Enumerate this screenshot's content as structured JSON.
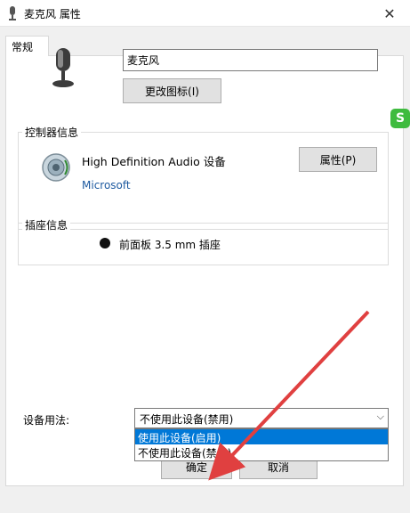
{
  "window": {
    "title": "麦克风 属性"
  },
  "tabs": [
    {
      "label": "常规"
    }
  ],
  "device": {
    "name_value": "麦克风",
    "change_icon_label": "更改图标(I)"
  },
  "controller": {
    "group_label": "控制器信息",
    "device_name": "High Definition Audio 设备",
    "manufacturer": "Microsoft",
    "properties_label": "属性(P)"
  },
  "jack": {
    "group_label": "插座信息",
    "description": "前面板 3.5 mm 插座",
    "color": "#111111"
  },
  "usage": {
    "label": "设备用法:",
    "selected": "不使用此设备(禁用)",
    "options": [
      {
        "label": "使用此设备(启用)",
        "highlighted": true
      },
      {
        "label": "不使用此设备(禁用)",
        "highlighted": false
      }
    ]
  },
  "footer": {
    "ok_label": "确定",
    "cancel_label": "取消"
  },
  "overlay": {
    "badge_letter": "S",
    "arrow_color": "#e04040"
  },
  "icons": [
    "mic-icon",
    "speaker-icon",
    "close-icon",
    "chevron-down-icon"
  ]
}
